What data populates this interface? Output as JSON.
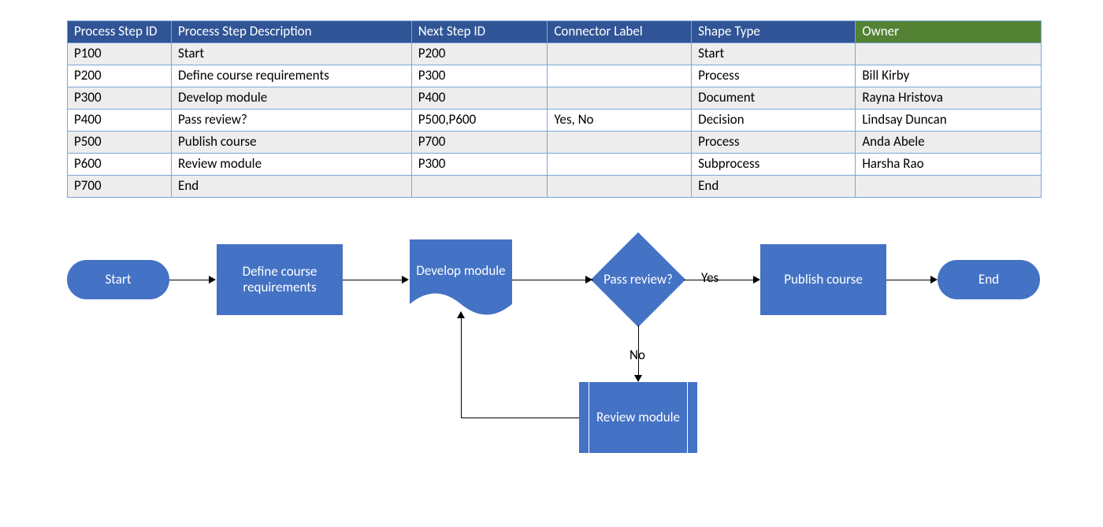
{
  "table": {
    "headers": [
      "Process Step ID",
      "Process Step Description",
      "Next Step ID",
      "Connector Label",
      "Shape Type",
      "Owner"
    ],
    "rows": [
      {
        "id": "P100",
        "desc": "Start",
        "next": "P200",
        "conn": "",
        "shape": "Start",
        "owner": ""
      },
      {
        "id": "P200",
        "desc": "Define course requirements",
        "next": "P300",
        "conn": "",
        "shape": "Process",
        "owner": "Bill Kirby"
      },
      {
        "id": "P300",
        "desc": "Develop module",
        "next": "P400",
        "conn": "",
        "shape": "Document",
        "owner": "Rayna Hristova"
      },
      {
        "id": "P400",
        "desc": "Pass review?",
        "next": "P500,P600",
        "conn": "Yes, No",
        "shape": "Decision",
        "owner": "Lindsay Duncan"
      },
      {
        "id": "P500",
        "desc": "Publish course",
        "next": "P700",
        "conn": "",
        "shape": "Process",
        "owner": "Anda Abele"
      },
      {
        "id": "P600",
        "desc": "Review module",
        "next": "P300",
        "conn": "",
        "shape": "Subprocess",
        "owner": "Harsha Rao"
      },
      {
        "id": "P700",
        "desc": "End",
        "next": "",
        "conn": "",
        "shape": "End",
        "owner": ""
      }
    ]
  },
  "flow": {
    "start": "Start",
    "p200": "Define course requirements",
    "p300": "Develop module",
    "p400": "Pass review?",
    "p500": "Publish course",
    "p600": "Review module",
    "end": "End",
    "yes": "Yes",
    "no": "No"
  }
}
